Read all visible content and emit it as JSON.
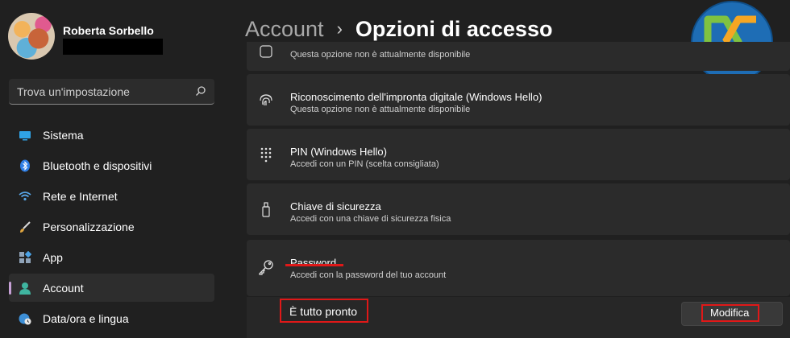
{
  "user": {
    "name": "Roberta Sorbello"
  },
  "search": {
    "placeholder": "Trova un'impostazione"
  },
  "nav": {
    "items": [
      {
        "label": "Sistema",
        "icon": "monitor-icon"
      },
      {
        "label": "Bluetooth e dispositivi",
        "icon": "bluetooth-icon"
      },
      {
        "label": "Rete e Internet",
        "icon": "wifi-icon"
      },
      {
        "label": "Personalizzazione",
        "icon": "brush-icon"
      },
      {
        "label": "App",
        "icon": "apps-icon"
      },
      {
        "label": "Account",
        "icon": "person-icon",
        "active": true
      },
      {
        "label": "Data/ora e lingua",
        "icon": "globe-clock-icon"
      }
    ]
  },
  "header": {
    "parent": "Account",
    "separator": "›",
    "current": "Opzioni di accesso"
  },
  "options": [
    {
      "title": "",
      "subtitle": "Questa opzione non è attualmente disponibile",
      "icon": "face-icon"
    },
    {
      "title": "Riconoscimento dell'impronta digitale (Windows Hello)",
      "subtitle": "Questa opzione non è attualmente disponibile",
      "icon": "fingerprint-icon"
    },
    {
      "title": "PIN (Windows Hello)",
      "subtitle": "Accedi con un PIN (scelta consigliata)",
      "icon": "keypad-icon"
    },
    {
      "title": "Chiave di sicurezza",
      "subtitle": "Accedi con una chiave di sicurezza fisica",
      "icon": "usb-key-icon"
    },
    {
      "title": "Password",
      "subtitle": "Accedi con la password del tuo account",
      "icon": "key-icon"
    }
  ],
  "password_status": {
    "label": "È tutto pronto",
    "button": "Modifica"
  },
  "colors": {
    "accent": "#c7a0d6",
    "highlight": "#e01818",
    "logo_bg": "#1e6db5",
    "logo_green": "#7fc241",
    "logo_orange": "#f5a623"
  }
}
